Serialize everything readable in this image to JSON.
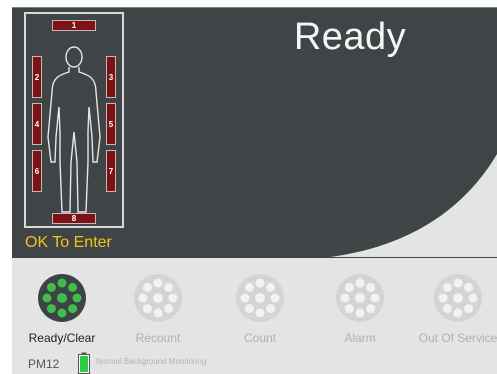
{
  "status": {
    "title": "Ready"
  },
  "portal": {
    "detectors": [
      "1",
      "2",
      "3",
      "4",
      "5",
      "6",
      "7",
      "8"
    ],
    "enter_label": "OK To Enter"
  },
  "modes": [
    {
      "label": "Ready/Clear",
      "state": "active",
      "icon": "detector-ring-icon"
    },
    {
      "label": "Recount",
      "state": "inactive",
      "icon": "detector-ring-icon"
    },
    {
      "label": "Count",
      "state": "inactive",
      "icon": "detector-ring-icon"
    },
    {
      "label": "Alarm",
      "state": "inactive",
      "icon": "detector-ring-icon"
    },
    {
      "label": "Out Of Service",
      "state": "inactive",
      "icon": "detector-ring-icon"
    }
  ],
  "status_bar": {
    "unit_id": "PM12",
    "message": "Normal Background Monitoring",
    "battery_icon": "battery-icon"
  },
  "colors": {
    "panel": "#3f4447",
    "detector": "#7b1214",
    "enter_label": "#f0c419",
    "active_green": "#3fbf4a",
    "inactive_gray": "#d9d9d9"
  }
}
